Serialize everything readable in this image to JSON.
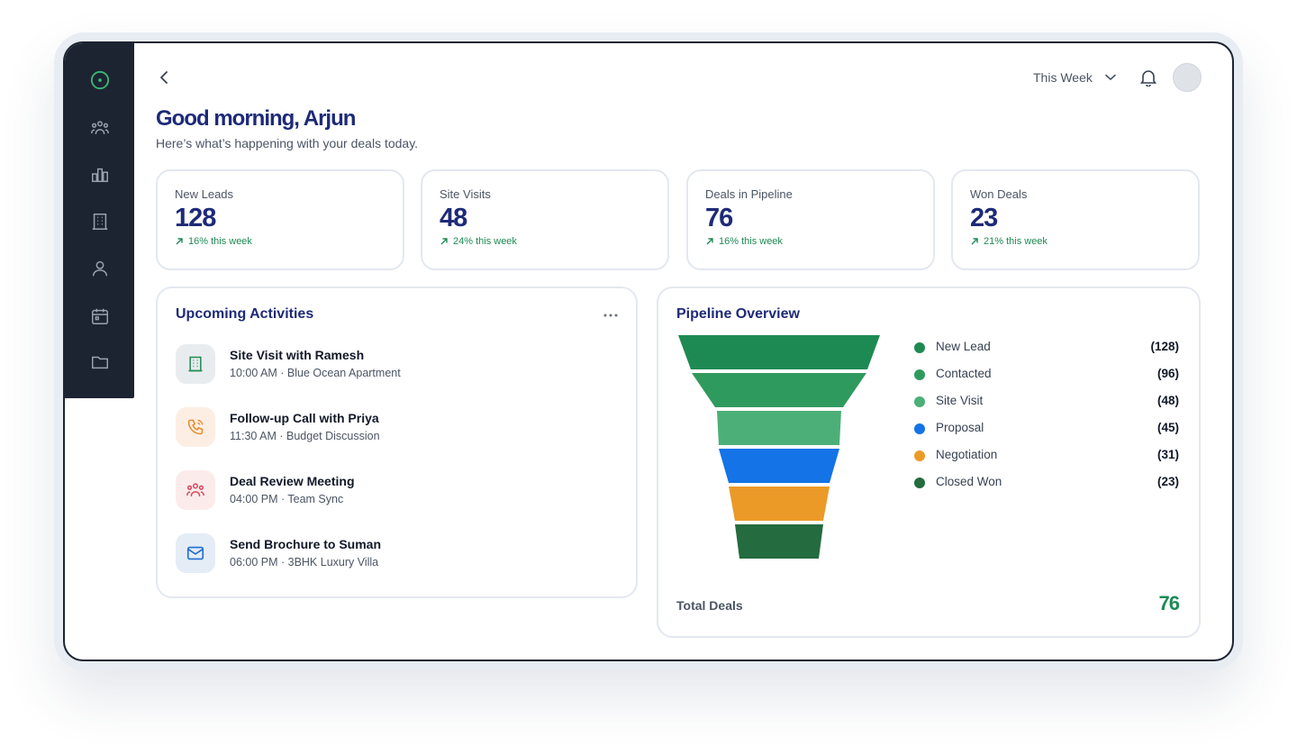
{
  "header": {
    "period": "This Week",
    "greeting": "Good morning, Arjun",
    "subtitle": "Here’s what’s happening with your deals today."
  },
  "sidebar": {
    "items": [
      {
        "icon": "logo-circle-icon"
      },
      {
        "icon": "users-icon"
      },
      {
        "icon": "bar-chart-icon"
      },
      {
        "icon": "building-icon"
      },
      {
        "icon": "user-icon"
      },
      {
        "icon": "calendar-icon"
      },
      {
        "icon": "folder-icon"
      }
    ]
  },
  "stats": [
    {
      "label": "New Leads",
      "value": "128",
      "trend": "16% this week"
    },
    {
      "label": "Site Visits",
      "value": "48",
      "trend": "24% this week"
    },
    {
      "label": "Deals in Pipeline",
      "value": "76",
      "trend": "16% this week"
    },
    {
      "label": "Won Deals",
      "value": "23",
      "trend": "21% this week"
    }
  ],
  "activities": {
    "title": "Upcoming Activities",
    "items": [
      {
        "title": "Site Visit with Ramesh",
        "sub": "10:00 AM · Blue Ocean Apartment",
        "icon": "building-icon",
        "color": "#1e8a53",
        "bg": "#e8ecef"
      },
      {
        "title": "Follow-up Call with Priya",
        "sub": "11:30 AM · Budget Discussion",
        "icon": "phone-icon",
        "color": "#e8892a",
        "bg": "#fdeee3"
      },
      {
        "title": "Deal Review Meeting",
        "sub": "04:00 PM · Team Sync",
        "icon": "team-icon",
        "color": "#d9435a",
        "bg": "#fbeceb"
      },
      {
        "title": "Send Brochure to Suman",
        "sub": "06:00 PM · 3BHK Luxury Villa",
        "icon": "mail-icon",
        "color": "#1f6fd1",
        "bg": "#e4ecf6"
      }
    ]
  },
  "pipeline": {
    "title": "Pipeline Overview",
    "total_label": "Total Deals",
    "total_value": "76"
  },
  "chart_data": {
    "type": "funnel",
    "title": "Pipeline Overview",
    "categories": [
      "New Lead",
      "Contacted",
      "Site Visit",
      "Proposal",
      "Negotiation",
      "Closed Won"
    ],
    "values": [
      128,
      96,
      48,
      45,
      31,
      23
    ],
    "labels": [
      "(128)",
      "(96)",
      "(48)",
      "(45)",
      "(31)",
      "(23)"
    ],
    "colors": [
      "#1e8a53",
      "#2f9a5e",
      "#4caf78",
      "#1473e6",
      "#ec9a27",
      "#246b3f"
    ]
  }
}
